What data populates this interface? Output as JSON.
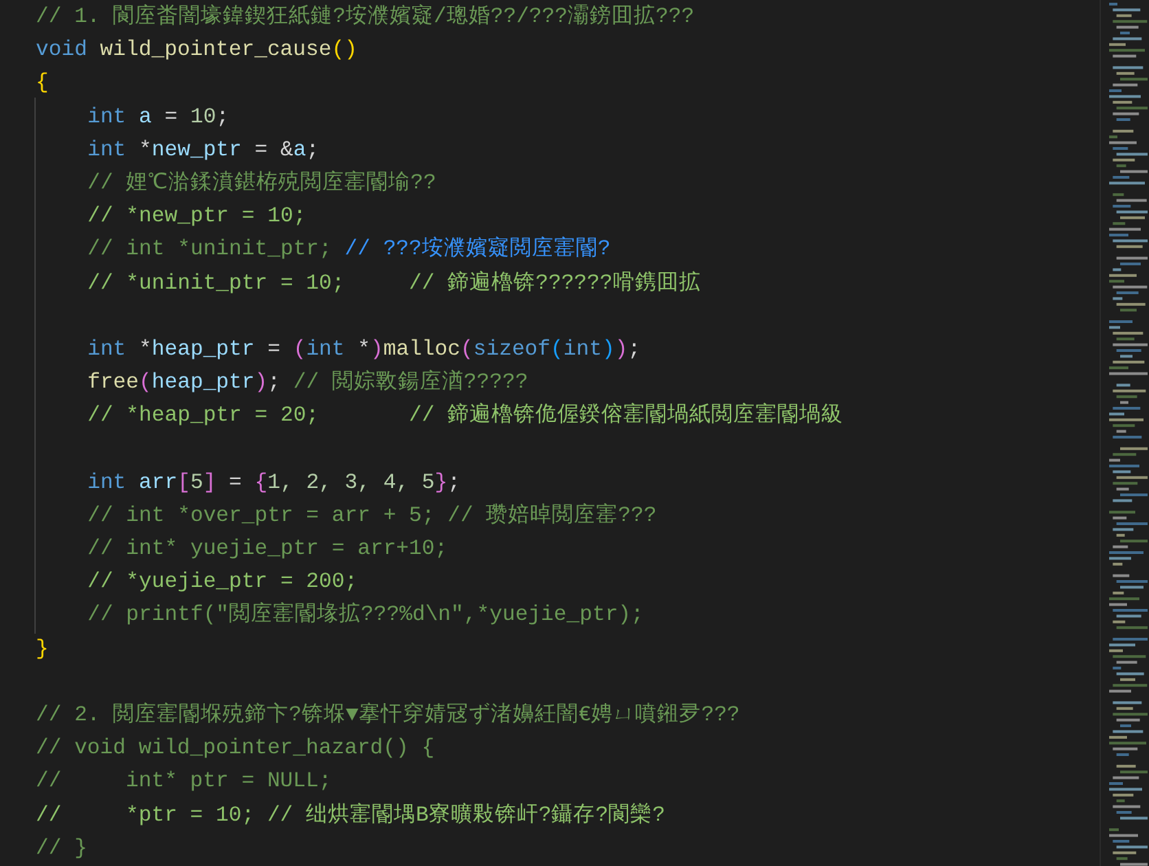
{
  "editor": {
    "lines": [
      {
        "kind": "code",
        "indented": false,
        "tokens": [
          {
            "text": "// 1. 閬庢畨闇壕鍏鍥狂紙鏈?垵濮嬪寲/璁婚??/???灞鎊囬拡???",
            "kind": "c"
          }
        ]
      },
      {
        "kind": "code",
        "indented": false,
        "tokens": [
          {
            "text": "void",
            "kind": "kw"
          },
          {
            "text": " wild_pointer_cause",
            "kind": "fn"
          },
          {
            "text": "()",
            "kind": "b1"
          }
        ]
      },
      {
        "kind": "code",
        "indented": false,
        "tokens": [
          {
            "text": "{",
            "kind": "b1"
          }
        ]
      },
      {
        "kind": "code",
        "indented": true,
        "tokens": [
          {
            "text": "int",
            "kind": "kw"
          },
          {
            "text": " a",
            "kind": "var"
          },
          {
            "text": " = ",
            "kind": "op"
          },
          {
            "text": "10",
            "kind": "num"
          },
          {
            "text": ";",
            "kind": "op"
          }
        ]
      },
      {
        "kind": "code",
        "indented": true,
        "tokens": [
          {
            "text": "int",
            "kind": "kw"
          },
          {
            "text": " *",
            "kind": "op"
          },
          {
            "text": "new_ptr",
            "kind": "var"
          },
          {
            "text": " = &",
            "kind": "op"
          },
          {
            "text": "a",
            "kind": "var"
          },
          {
            "text": ";",
            "kind": "op"
          }
        ]
      },
      {
        "kind": "code",
        "indented": true,
        "tokens": [
          {
            "text": "// 娌℃湁鍒濆鍖栫殑閲庢寚閽堬??",
            "kind": "c"
          }
        ]
      },
      {
        "kind": "code",
        "indented": true,
        "tokens": [
          {
            "text": "// *new_ptr = 10;",
            "kind": "cb"
          }
        ]
      },
      {
        "kind": "code",
        "indented": true,
        "tokens": [
          {
            "text": "// int *uninit_ptr; ",
            "kind": "c"
          },
          {
            "text": "// ???垵濮嬪寲閲庢寚閽?",
            "kind": "cl"
          }
        ]
      },
      {
        "kind": "code",
        "indented": true,
        "tokens": [
          {
            "text": "// *uninit_ptr = 10;     // 鍗遍櫓锛??????嗗鎸囬拡",
            "kind": "cb"
          }
        ]
      },
      {
        "kind": "blank"
      },
      {
        "kind": "code",
        "indented": true,
        "tokens": [
          {
            "text": "int",
            "kind": "kw"
          },
          {
            "text": " *",
            "kind": "op"
          },
          {
            "text": "heap_ptr",
            "kind": "var"
          },
          {
            "text": " = ",
            "kind": "op"
          },
          {
            "text": "(",
            "kind": "b2"
          },
          {
            "text": "int",
            "kind": "kw"
          },
          {
            "text": " *",
            "kind": "op"
          },
          {
            "text": ")",
            "kind": "b2"
          },
          {
            "text": "malloc",
            "kind": "fn"
          },
          {
            "text": "(",
            "kind": "b2"
          },
          {
            "text": "sizeof",
            "kind": "kw"
          },
          {
            "text": "(",
            "kind": "b3"
          },
          {
            "text": "int",
            "kind": "kw"
          },
          {
            "text": ")",
            "kind": "b3"
          },
          {
            "text": ")",
            "kind": "b2"
          },
          {
            "text": ";",
            "kind": "op"
          }
        ]
      },
      {
        "kind": "code",
        "indented": true,
        "tokens": [
          {
            "text": "free",
            "kind": "fn"
          },
          {
            "text": "(",
            "kind": "b2"
          },
          {
            "text": "heap_ptr",
            "kind": "var"
          },
          {
            "text": ")",
            "kind": "b2"
          },
          {
            "text": ";",
            "kind": "op"
          },
          {
            "text": " // 閲婃斁鍚庢湭?????",
            "kind": "c"
          }
        ]
      },
      {
        "kind": "code",
        "indented": true,
        "tokens": [
          {
            "text": "// *heap_ptr = 20;       // 鍗遍櫓锛佹偓鍨傛寚閽堝紙閲庢寚閽堝級",
            "kind": "cb"
          }
        ]
      },
      {
        "kind": "blank"
      },
      {
        "kind": "code",
        "indented": true,
        "tokens": [
          {
            "text": "int",
            "kind": "kw"
          },
          {
            "text": " arr",
            "kind": "var"
          },
          {
            "text": "[",
            "kind": "b2"
          },
          {
            "text": "5",
            "kind": "num"
          },
          {
            "text": "]",
            "kind": "b2"
          },
          {
            "text": " = ",
            "kind": "op"
          },
          {
            "text": "{",
            "kind": "b2"
          },
          {
            "text": "1, 2, 3, 4, 5",
            "kind": "num"
          },
          {
            "text": "}",
            "kind": "b2"
          },
          {
            "text": ";",
            "kind": "op"
          }
        ]
      },
      {
        "kind": "code",
        "indented": true,
        "tokens": [
          {
            "text": "// int *over_ptr = arr + 5; // 瓒婄晫閲庢寚???",
            "kind": "c"
          }
        ]
      },
      {
        "kind": "code",
        "indented": true,
        "tokens": [
          {
            "text": "// int* yuejie_ptr = arr+10;",
            "kind": "c"
          }
        ]
      },
      {
        "kind": "code",
        "indented": true,
        "tokens": [
          {
            "text": "// *yuejie_ptr = 200;",
            "kind": "cb"
          }
        ]
      },
      {
        "kind": "code",
        "indented": true,
        "tokens": [
          {
            "text": "// printf(\"閲庢寚閽堟拡???%d\\n\",*yuejie_ptr);",
            "kind": "c"
          }
        ]
      },
      {
        "kind": "code",
        "indented": false,
        "tokens": [
          {
            "text": "}",
            "kind": "b1"
          }
        ]
      },
      {
        "kind": "blank"
      },
      {
        "kind": "code",
        "indented": false,
        "tokens": [
          {
            "text": "// 2. 閲庢寚閽堢殑鍗卞?锛堢▼搴忓穿婧冦ず渚嬶紝闇€娉ㄩ噴鎺夛???",
            "kind": "c"
          }
        ]
      },
      {
        "kind": "code",
        "indented": false,
        "tokens": [
          {
            "text": "// void wild_pointer_hazard() {",
            "kind": "c"
          }
        ]
      },
      {
        "kind": "code",
        "indented": false,
        "tokens": [
          {
            "text": "//     int* ptr = NULL;",
            "kind": "c"
          }
        ]
      },
      {
        "kind": "code",
        "indented": false,
        "tokens": [
          {
            "text": "//     *ptr = 10; // 绌烘寚閽堣В寮曠敤锛屽?鑷存?閬欒?",
            "kind": "cb"
          }
        ]
      },
      {
        "kind": "code",
        "indented": false,
        "tokens": [
          {
            "text": "// }",
            "kind": "c"
          }
        ]
      }
    ]
  }
}
